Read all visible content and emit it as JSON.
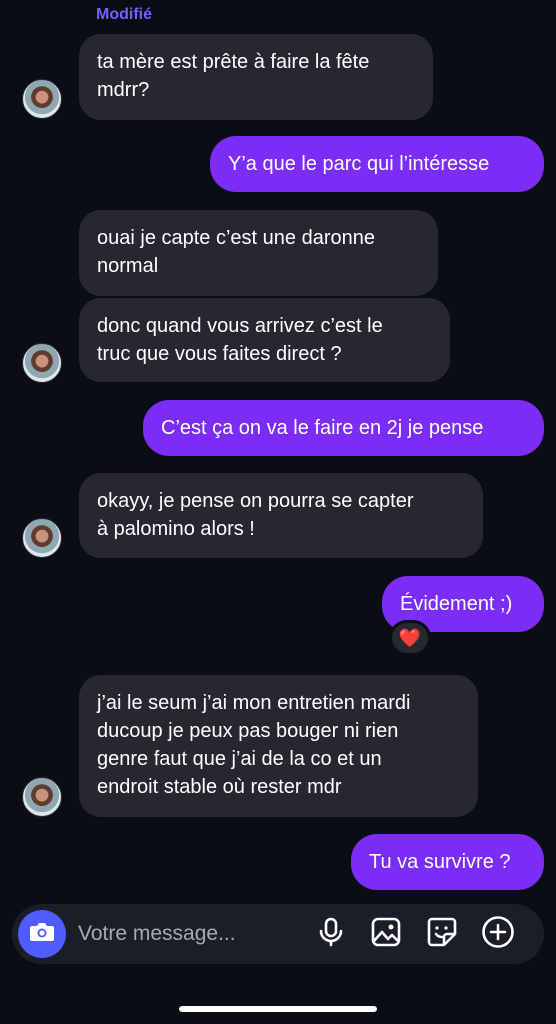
{
  "header": {
    "edited_label": "Modifié"
  },
  "messages": [
    {
      "text": "ta mère est prête à faire la fête\nmdrr?"
    },
    {
      "text": "Y’a que le parc qui l’intéresse"
    },
    {
      "text": "ouai je capte c’est une daronne\nnormal"
    },
    {
      "text": "donc quand vous arrivez c’est le\ntruc que vous faites direct ?"
    },
    {
      "text": "C’est ça on va le faire en 2j je pense"
    },
    {
      "text": "okayy, je pense on pourra se capter\nà palomino alors !"
    },
    {
      "text": "Évidement ;)"
    },
    {
      "text": "j’ai le seum j’ai mon entretien mardi\nducoup je peux pas bouger ni rien\ngenre faut que j’ai de la co et un\nendroit stable où rester mdr"
    },
    {
      "text": "Tu va survivre ?"
    }
  ],
  "reaction": {
    "emoji": "❤️"
  },
  "composer": {
    "placeholder": "Votre message..."
  },
  "icons": [
    "camera-icon",
    "microphone-icon",
    "image-icon",
    "sticker-icon",
    "plus-icon"
  ],
  "colors": {
    "outgoing": "#7b2cf5",
    "incoming": "#26272f",
    "accent": "#4f5cff",
    "edited": "#6c63ff"
  }
}
